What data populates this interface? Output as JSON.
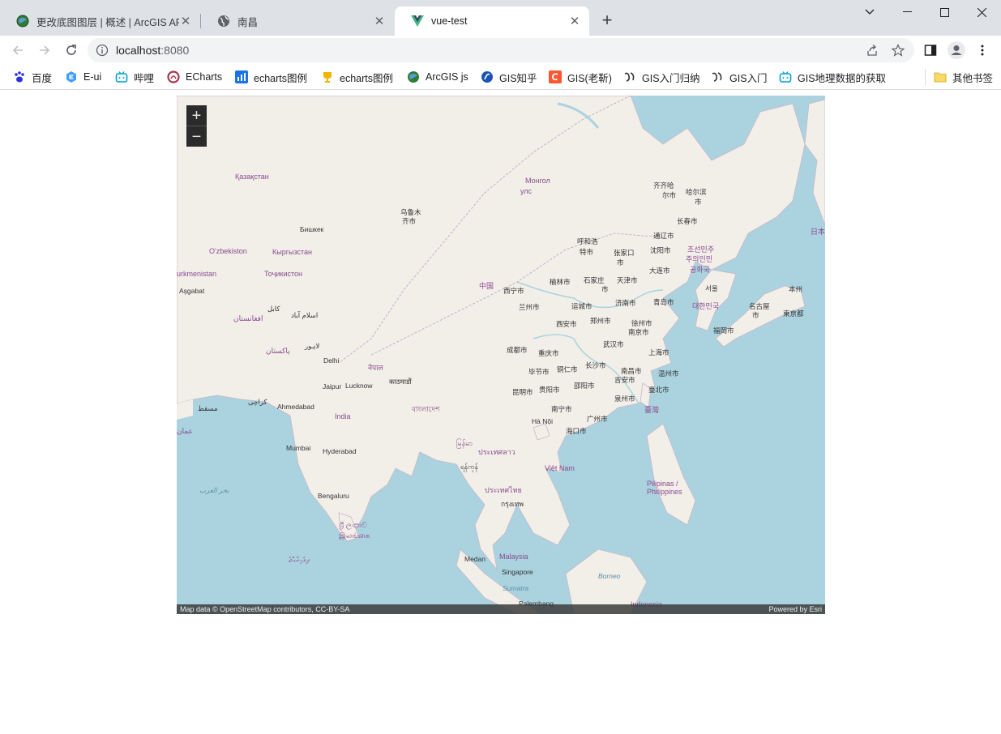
{
  "tabs": [
    {
      "title": "更改底图图层 | 概述 | ArcGIS API",
      "icon": "arcgis-globe-icon"
    },
    {
      "title": "南昌",
      "icon": "globe-icon"
    },
    {
      "title": "vue-test",
      "icon": "vue-icon",
      "active": true
    }
  ],
  "toolbar": {
    "url_host": "localhost",
    "url_port": ":8080"
  },
  "bookmarks": [
    {
      "label": "百度",
      "icon": "baidu-paw-icon",
      "color": "#2932e1"
    },
    {
      "label": "E-ui",
      "icon": "element-ui-icon",
      "color": "#409eff"
    },
    {
      "label": "哔哩",
      "icon": "bilibili-icon",
      "color": "#00a1d6"
    },
    {
      "label": "ECharts",
      "icon": "echarts-icon",
      "color": "#aa344d"
    },
    {
      "label": "echarts图例",
      "icon": "bar-chart-icon",
      "color": "#1a73e8"
    },
    {
      "label": "echarts图例",
      "icon": "trophy-icon",
      "color": "#f4b400"
    },
    {
      "label": "ArcGIS js",
      "icon": "arcgis-globe-icon",
      "color": "#2e7d32"
    },
    {
      "label": "GIS知乎",
      "icon": "zhihu-icon",
      "color": "#1a53b5"
    },
    {
      "label": "GIS(老靳)",
      "icon": "csdn-icon",
      "color": "#fc5531"
    },
    {
      "label": "GIS入门归纳",
      "icon": "yuque-icon",
      "color": "#333333"
    },
    {
      "label": "GIS入门",
      "icon": "yuque-icon",
      "color": "#333333"
    },
    {
      "label": "GIS地理数据的获取",
      "icon": "bilibili-icon",
      "color": "#00a1d6"
    }
  ],
  "other_bookmarks": "其他书签",
  "map": {
    "zoom_in": "+",
    "zoom_out": "−",
    "attribution_left": "Map data © OpenStreetMap contributors, CC-BY-SA",
    "attribution_right": "Powered by Esri",
    "labels": [
      {
        "text": "Қазақстан",
        "kind": "country"
      },
      {
        "text": "Монгол",
        "kind": "country"
      },
      {
        "text": "улс",
        "kind": "country"
      },
      {
        "text": "乌鲁木",
        "kind": "city"
      },
      {
        "text": "齐市",
        "kind": "city"
      },
      {
        "text": "Бишкек",
        "kind": "city"
      },
      {
        "text": "O'zbekiston",
        "kind": "country"
      },
      {
        "text": "Кыргызстан",
        "kind": "country"
      },
      {
        "text": "Тоҷикистон",
        "kind": "country"
      },
      {
        "text": "urkmenistan",
        "kind": "country"
      },
      {
        "text": "Aşgabat",
        "kind": "city"
      },
      {
        "text": "افغانستان",
        "kind": "country"
      },
      {
        "text": "کابل",
        "kind": "city"
      },
      {
        "text": "اسلام آباد",
        "kind": "city"
      },
      {
        "text": "پاکستان",
        "kind": "country"
      },
      {
        "text": "لاہور",
        "kind": "city"
      },
      {
        "text": "Delhi",
        "kind": "city"
      },
      {
        "text": "नेपाल",
        "kind": "country"
      },
      {
        "text": "काठमाडौं",
        "kind": "city"
      },
      {
        "text": "Jaipur",
        "kind": "city"
      },
      {
        "text": "Lucknow",
        "kind": "city"
      },
      {
        "text": "کراچی",
        "kind": "city"
      },
      {
        "text": "مسقط",
        "kind": "city"
      },
      {
        "text": "عمان",
        "kind": "country"
      },
      {
        "text": "Ahmedabad",
        "kind": "city"
      },
      {
        "text": "India",
        "kind": "country"
      },
      {
        "text": "বাংলাদেশ",
        "kind": "country"
      },
      {
        "text": "Mumbai",
        "kind": "city"
      },
      {
        "text": "Hyderabad",
        "kind": "city"
      },
      {
        "text": "بحر العرب",
        "kind": "sea"
      },
      {
        "text": "Bengaluru",
        "kind": "city"
      },
      {
        "text": "ශ්‍රී ලංකාව",
        "kind": "country"
      },
      {
        "text": "இலங்கை",
        "kind": "country"
      },
      {
        "text": "ދިވެހިރާއްޖެ",
        "kind": "country"
      },
      {
        "text": "မြန်မာ",
        "kind": "country"
      },
      {
        "text": "ရန်ကုန်",
        "kind": "city"
      },
      {
        "text": "ประเทศลาว",
        "kind": "country"
      },
      {
        "text": "ประเทศไทย",
        "kind": "country"
      },
      {
        "text": "กรุงเทพ",
        "kind": "city"
      },
      {
        "text": "Việt Nam",
        "kind": "country"
      },
      {
        "text": "Hà Nội",
        "kind": "city"
      },
      {
        "text": "Medan",
        "kind": "city"
      },
      {
        "text": "Malaysia",
        "kind": "country"
      },
      {
        "text": "Singapore",
        "kind": "city"
      },
      {
        "text": "Sumatra",
        "kind": "sea"
      },
      {
        "text": "Borneo",
        "kind": "sea"
      },
      {
        "text": "Palembang",
        "kind": "city"
      },
      {
        "text": "Indonesia",
        "kind": "country"
      },
      {
        "text": "Pilipinas /",
        "kind": "country"
      },
      {
        "text": "Philippines",
        "kind": "country"
      },
      {
        "text": "中国",
        "kind": "country"
      },
      {
        "text": "西宁市",
        "kind": "city"
      },
      {
        "text": "兰州市",
        "kind": "city"
      },
      {
        "text": "榆林市",
        "kind": "city"
      },
      {
        "text": "呼和浩",
        "kind": "city"
      },
      {
        "text": "特市",
        "kind": "city"
      },
      {
        "text": "张家口",
        "kind": "city"
      },
      {
        "text": "市",
        "kind": "city"
      },
      {
        "text": "石家庄",
        "kind": "city"
      },
      {
        "text": "市",
        "kind": "city"
      },
      {
        "text": "天津市",
        "kind": "city"
      },
      {
        "text": "沈阳市",
        "kind": "city"
      },
      {
        "text": "大连市",
        "kind": "city"
      },
      {
        "text": "通辽市",
        "kind": "city"
      },
      {
        "text": "长春市",
        "kind": "city"
      },
      {
        "text": "齐齐哈",
        "kind": "city"
      },
      {
        "text": "尔市",
        "kind": "city"
      },
      {
        "text": "哈尔滨",
        "kind": "city"
      },
      {
        "text": "市",
        "kind": "city"
      },
      {
        "text": "运城市",
        "kind": "city"
      },
      {
        "text": "济南市",
        "kind": "city"
      },
      {
        "text": "青岛市",
        "kind": "city"
      },
      {
        "text": "西安市",
        "kind": "city"
      },
      {
        "text": "郑州市",
        "kind": "city"
      },
      {
        "text": "徐州市",
        "kind": "city"
      },
      {
        "text": "南京市",
        "kind": "city"
      },
      {
        "text": "上海市",
        "kind": "city"
      },
      {
        "text": "武汉市",
        "kind": "city"
      },
      {
        "text": "成都市",
        "kind": "city"
      },
      {
        "text": "重庆市",
        "kind": "city"
      },
      {
        "text": "长沙市",
        "kind": "city"
      },
      {
        "text": "南昌市",
        "kind": "city"
      },
      {
        "text": "毕节市",
        "kind": "city"
      },
      {
        "text": "铜仁市",
        "kind": "city"
      },
      {
        "text": "邵阳市",
        "kind": "city"
      },
      {
        "text": "吉安市",
        "kind": "city"
      },
      {
        "text": "温州市",
        "kind": "city"
      },
      {
        "text": "昆明市",
        "kind": "city"
      },
      {
        "text": "贵阳市",
        "kind": "city"
      },
      {
        "text": "泉州市",
        "kind": "city"
      },
      {
        "text": "臺北市",
        "kind": "city"
      },
      {
        "text": "臺灣",
        "kind": "country"
      },
      {
        "text": "南宁市",
        "kind": "city"
      },
      {
        "text": "广州市",
        "kind": "city"
      },
      {
        "text": "海口市",
        "kind": "city"
      },
      {
        "text": "조선민주",
        "kind": "country"
      },
      {
        "text": "주의인민",
        "kind": "country"
      },
      {
        "text": "공화국",
        "kind": "country"
      },
      {
        "text": "서울",
        "kind": "city"
      },
      {
        "text": "대한민국",
        "kind": "country"
      },
      {
        "text": "福岡市",
        "kind": "city"
      },
      {
        "text": "名古屋",
        "kind": "city"
      },
      {
        "text": "市",
        "kind": "city"
      },
      {
        "text": "本州",
        "kind": "city"
      },
      {
        "text": "東京都",
        "kind": "city"
      },
      {
        "text": "日本",
        "kind": "country"
      }
    ]
  }
}
